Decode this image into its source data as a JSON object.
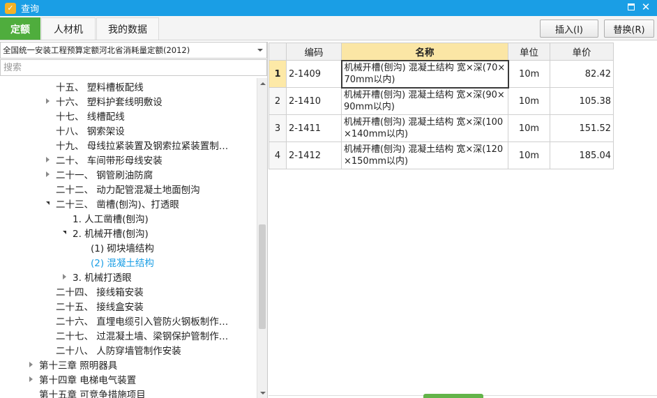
{
  "window": {
    "title": "查询",
    "close_glyph": "✕"
  },
  "tabs": [
    {
      "label": "定额",
      "active": true
    },
    {
      "label": "人材机",
      "active": false
    },
    {
      "label": "我的数据",
      "active": false
    }
  ],
  "actions": {
    "insert_label": "插入(I)",
    "replace_label": "替换(R)"
  },
  "left": {
    "quota_selected": "全国统一安装工程预算定额河北省消耗量定额(2012)",
    "search_placeholder": "搜索",
    "tree": [
      {
        "label": "十五、 塑料槽板配线",
        "toggle": "none",
        "level": 1
      },
      {
        "label": "十六、 塑料护套线明敷设",
        "toggle": "collapsed",
        "level": 1
      },
      {
        "label": "十七、 线槽配线",
        "toggle": "none",
        "level": 1
      },
      {
        "label": "十八、 钢索架设",
        "toggle": "none",
        "level": 1
      },
      {
        "label": "十九、 母线拉紧装置及钢索拉紧装置制…",
        "toggle": "none",
        "level": 1
      },
      {
        "label": "二十、 车间带形母线安装",
        "toggle": "collapsed",
        "level": 1
      },
      {
        "label": "二十一、 钢管刷油防腐",
        "toggle": "collapsed",
        "level": 1
      },
      {
        "label": "二十二、 动力配管混凝土地面刨沟",
        "toggle": "none",
        "level": 1
      },
      {
        "label": "二十三、 凿槽(刨沟)、打透眼",
        "toggle": "expanded",
        "level": 1
      },
      {
        "label": "1. 人工凿槽(刨沟)",
        "toggle": "none",
        "level": 2
      },
      {
        "label": "2. 机械开槽(刨沟)",
        "toggle": "expanded",
        "level": 2
      },
      {
        "label": "(1) 砌块墙结构",
        "toggle": "none",
        "level": 3
      },
      {
        "label": "(2) 混凝土结构",
        "toggle": "none",
        "level": 3,
        "selected": true
      },
      {
        "label": "3. 机械打透眼",
        "toggle": "collapsed",
        "level": 2
      },
      {
        "label": "二十四、 接线箱安装",
        "toggle": "none",
        "level": 1
      },
      {
        "label": "二十五、 接线盒安装",
        "toggle": "none",
        "level": 1
      },
      {
        "label": "二十六、 直埋电缆引入管防火钢板制作…",
        "toggle": "none",
        "level": 1
      },
      {
        "label": "二十七、 过混凝土墙、梁钢保护管制作…",
        "toggle": "none",
        "level": 1
      },
      {
        "label": "二十八、 人防穿墙管制作安装",
        "toggle": "none",
        "level": 1
      },
      {
        "label": "第十三章 照明器具",
        "toggle": "collapsed",
        "level": 0
      },
      {
        "label": "第十四章 电梯电气装置",
        "toggle": "collapsed",
        "level": 0
      },
      {
        "label": "第十五章 可竞争措施项目",
        "toggle": "none",
        "level": 0
      }
    ]
  },
  "grid": {
    "columns": {
      "code": "编码",
      "name": "名称",
      "unit": "单位",
      "price": "单价"
    },
    "rows": [
      {
        "num": "1",
        "code": "2-1409",
        "name": "机械开槽(刨沟) 混凝土结构 宽×深(70×70mm以内)",
        "unit": "10m",
        "price": "82.42"
      },
      {
        "num": "2",
        "code": "2-1410",
        "name": "机械开槽(刨沟) 混凝土结构 宽×深(90×90mm以内)",
        "unit": "10m",
        "price": "105.38"
      },
      {
        "num": "3",
        "code": "2-1411",
        "name": "机械开槽(刨沟) 混凝土结构 宽×深(100×140mm以内)",
        "unit": "10m",
        "price": "151.52"
      },
      {
        "num": "4",
        "code": "2-1412",
        "name": "机械开槽(刨沟) 混凝土结构 宽×深(120×150mm以内)",
        "unit": "10m",
        "price": "185.04"
      }
    ]
  },
  "colors": {
    "titlebar": "#1a9ee5",
    "active_tab": "#4fad3d",
    "selected_text": "#1a9ee5",
    "header_highlight": "#fbe6a5"
  }
}
